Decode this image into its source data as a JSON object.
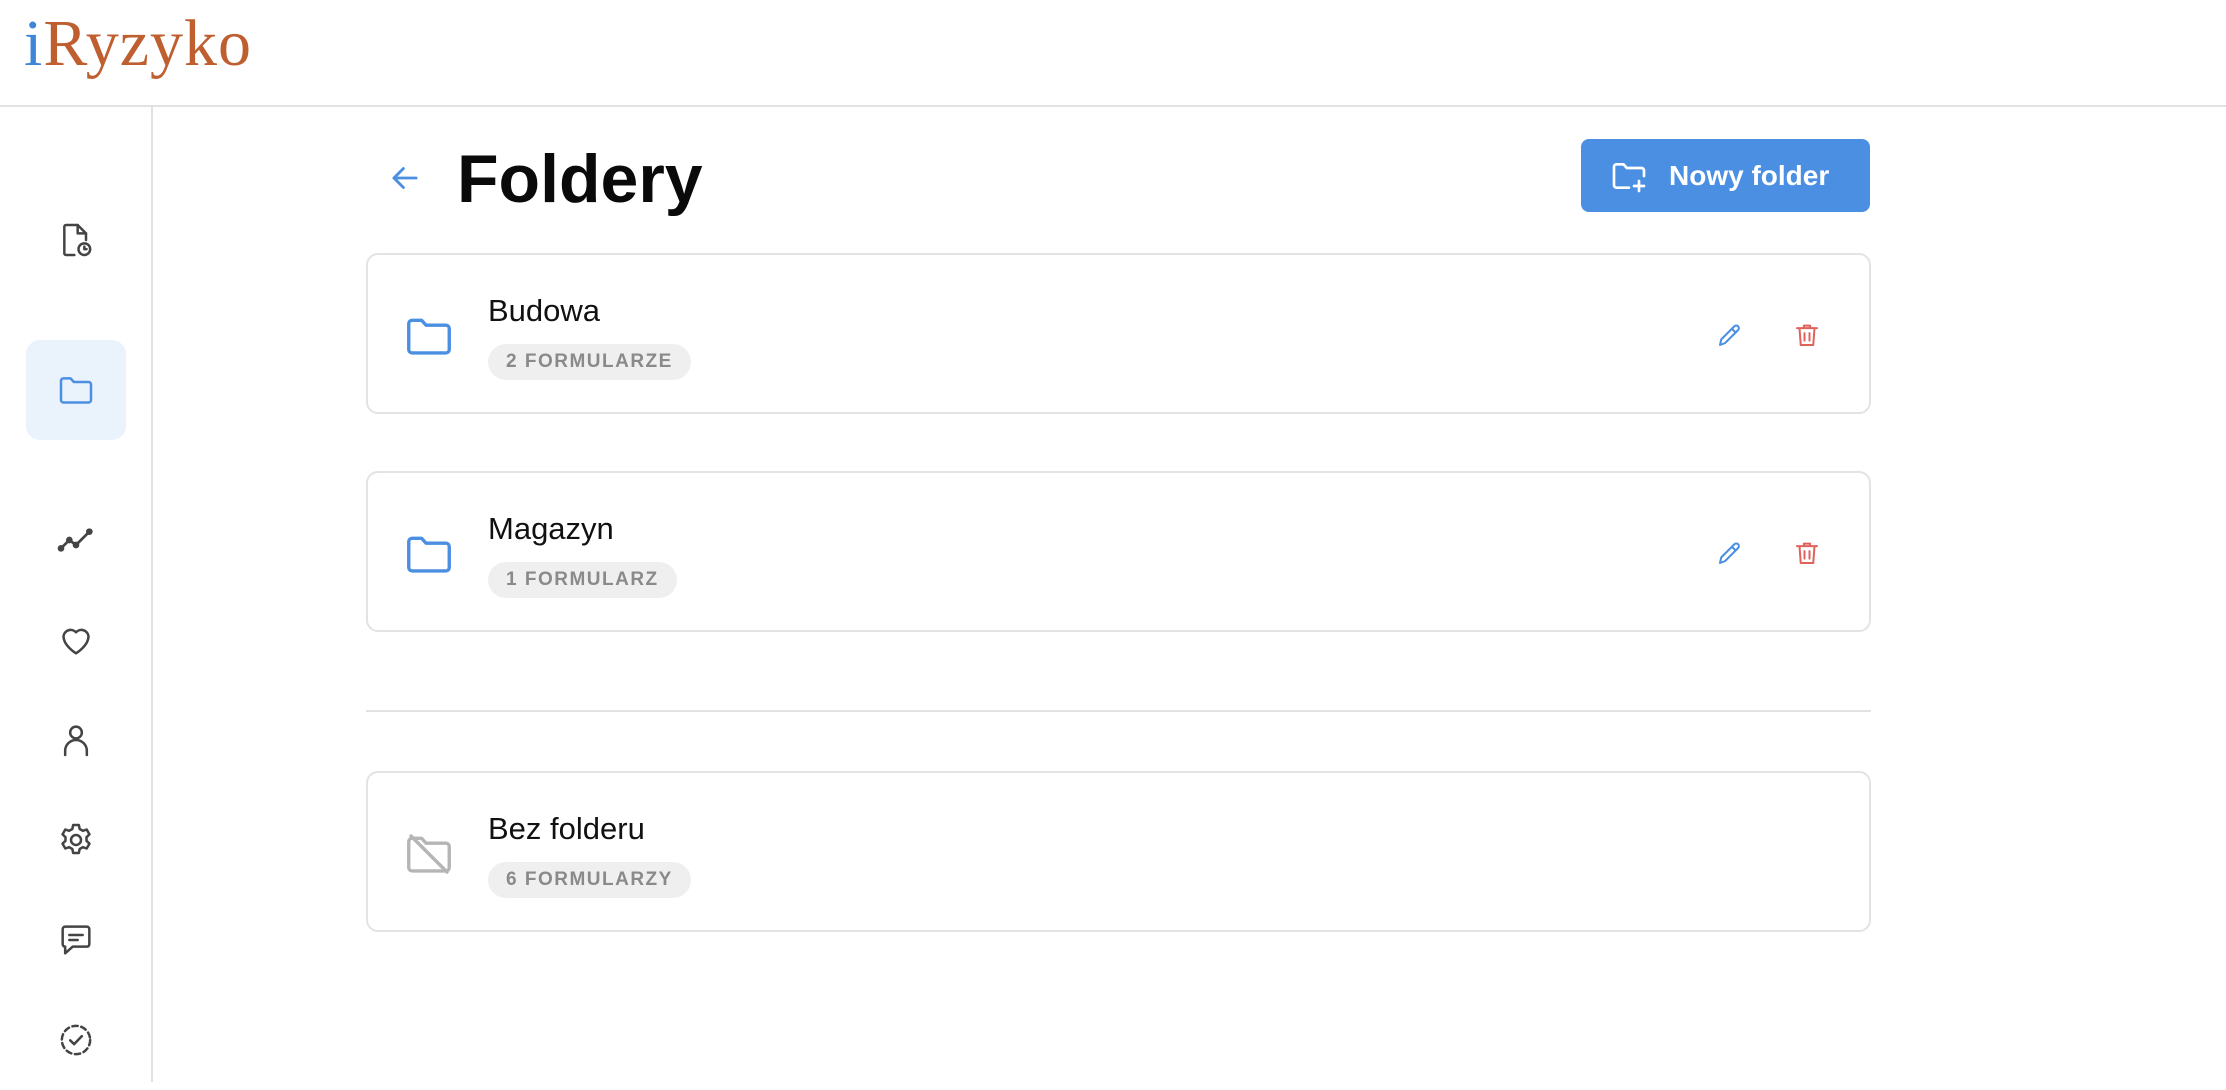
{
  "app": {
    "logo_i": "i",
    "logo_rest": "Ryzyko"
  },
  "sidebar": {
    "items": [
      {
        "icon": "report-clock-icon",
        "active": false
      },
      {
        "icon": "folder-icon",
        "active": true
      },
      {
        "icon": "trend-line-icon",
        "active": false
      },
      {
        "icon": "heart-icon",
        "active": false
      },
      {
        "icon": "user-icon",
        "active": false
      },
      {
        "icon": "gear-icon",
        "active": false
      },
      {
        "icon": "chat-icon",
        "active": false
      },
      {
        "icon": "dashed-check-circle-icon",
        "active": false
      }
    ]
  },
  "header": {
    "title": "Foldery",
    "new_folder_label": "Nowy folder"
  },
  "folders": [
    {
      "name": "Budowa",
      "count_label": "2 FORMULARZE"
    },
    {
      "name": "Magazyn",
      "count_label": "1 FORMULARZ"
    }
  ],
  "unfiled": {
    "name": "Bez folderu",
    "count_label": "6 FORMULARZY"
  },
  "colors": {
    "accent": "#4a8fe2",
    "danger": "#e0625b",
    "logo_brown": "#bf5f30",
    "logo_blue": "#3f86d9",
    "muted_icon": "#b5b5b5"
  }
}
